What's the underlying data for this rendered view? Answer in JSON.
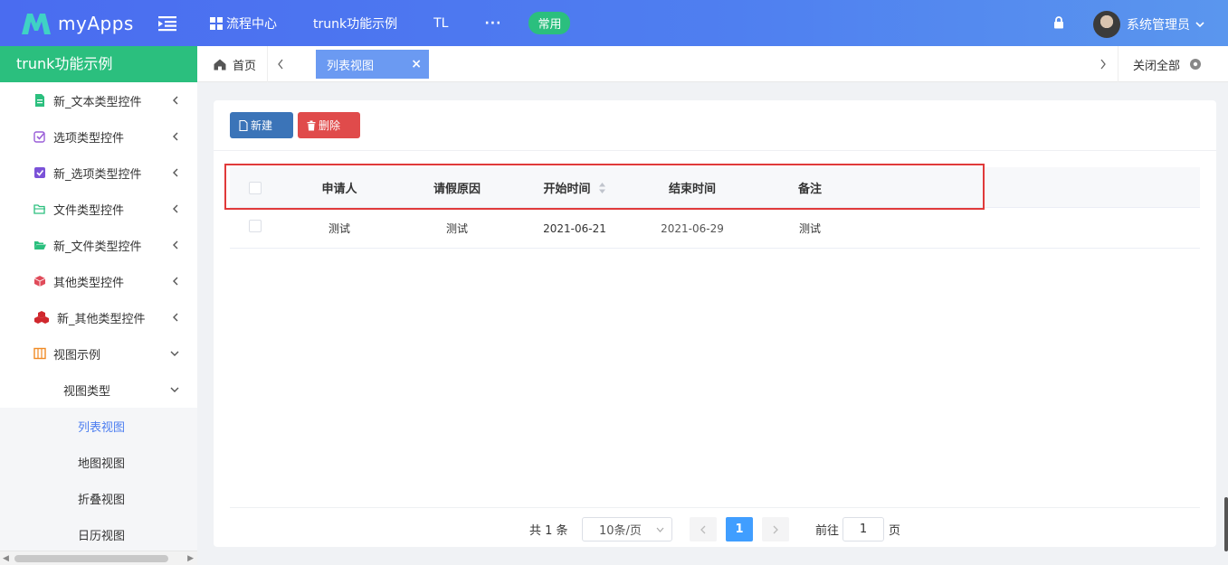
{
  "header": {
    "logo_text": "myApps",
    "nav": [
      {
        "label": "流程中心"
      },
      {
        "label": "trunk功能示例"
      },
      {
        "label": "TL"
      },
      {
        "label": "···"
      }
    ],
    "pill": "常用",
    "user_name": "系统管理员"
  },
  "sidebar": {
    "title": "trunk功能示例",
    "items": [
      {
        "label": "新_文本类型控件",
        "icon": "document-icon",
        "color": "#2bbf7e"
      },
      {
        "label": "选项类型控件",
        "icon": "checkbox-outline-icon",
        "color": "#9a5ed8"
      },
      {
        "label": "新_选项类型控件",
        "icon": "checkbox-filled-icon",
        "color": "#7b52d8"
      },
      {
        "label": "文件类型控件",
        "icon": "folder-outline-icon",
        "color": "#2bbf7e"
      },
      {
        "label": "新_文件类型控件",
        "icon": "folder-open-icon",
        "color": "#2bbf7e"
      },
      {
        "label": "其他类型控件",
        "icon": "cube-icon",
        "color": "#e04b5a"
      },
      {
        "label": "新_其他类型控件",
        "icon": "cubes-icon",
        "color": "#d0282e"
      },
      {
        "label": "视图示例",
        "icon": "columns-icon",
        "color": "#f08a24"
      }
    ],
    "sub_group": "视图类型",
    "leaves": [
      "列表视图",
      "地图视图",
      "折叠视图",
      "日历视图"
    ]
  },
  "tabs": {
    "home": "首页",
    "active": "列表视图",
    "close_all": "关闭全部"
  },
  "toolbar": {
    "new_label": "新建",
    "delete_label": "删除"
  },
  "table": {
    "columns": [
      "申请人",
      "请假原因",
      "开始时间",
      "结束时间",
      "备注"
    ],
    "rows": [
      [
        "测试",
        "测试",
        "2021-06-21",
        "2021-06-29",
        "测试"
      ]
    ]
  },
  "pagination": {
    "total": "共 1 条",
    "page_size": "10条/页",
    "current_page": "1",
    "goto_label": "前往",
    "goto_value": "1",
    "page_unit": "页"
  },
  "colors": {
    "accent": "#4a6cf0",
    "sidebar_title": "#2bbf7e",
    "highlight_box": "#e03a3a"
  }
}
